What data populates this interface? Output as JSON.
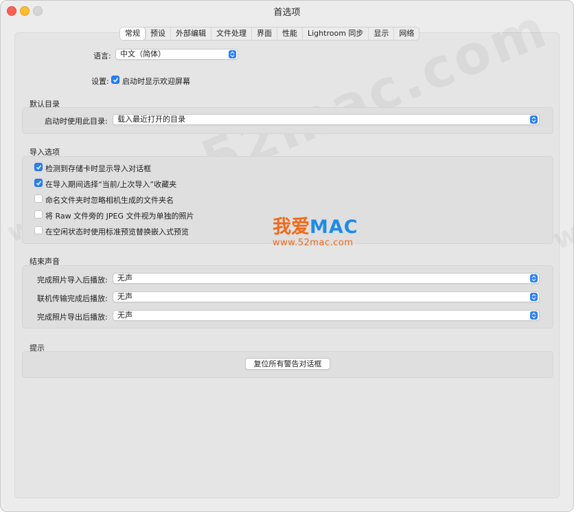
{
  "window": {
    "title": "首选项"
  },
  "tabs": [
    {
      "label": "常规",
      "active": true
    },
    {
      "label": "预设"
    },
    {
      "label": "外部编辑"
    },
    {
      "label": "文件处理"
    },
    {
      "label": "界面"
    },
    {
      "label": "性能"
    },
    {
      "label": "Lightroom 同步"
    },
    {
      "label": "显示"
    },
    {
      "label": "网络"
    }
  ],
  "general": {
    "language_label": "语言:",
    "language_value": "中文（简体）",
    "settings_label": "设置:",
    "show_splash_label": "启动时显示欢迎屏幕",
    "show_splash_checked": true
  },
  "default_catalog": {
    "section_title": "默认目录",
    "label": "启动时使用此目录:",
    "value": "载入最近打开的目录"
  },
  "import_options": {
    "section_title": "导入选项",
    "items": [
      {
        "label": "检测到存储卡时显示导入对话框",
        "checked": true
      },
      {
        "label": "在导入期间选择“当前/上次导入”收藏夹",
        "checked": true
      },
      {
        "label": "命名文件夹时忽略相机生成的文件夹名",
        "checked": false
      },
      {
        "label": "将 Raw 文件旁的 JPEG 文件视为单独的照片",
        "checked": false
      },
      {
        "label": "在空闲状态时使用标准预览替换嵌入式预览",
        "checked": false
      }
    ]
  },
  "completion_sounds": {
    "section_title": "结束声音",
    "rows": [
      {
        "label": "完成照片导入后播放:",
        "value": "无声"
      },
      {
        "label": "联机传输完成后播放:",
        "value": "无声"
      },
      {
        "label": "完成照片导出后播放:",
        "value": "无声"
      }
    ]
  },
  "prompts": {
    "section_title": "提示",
    "reset_button": "复位所有警告对话框"
  },
  "watermark": {
    "logo_cn": "我爱",
    "logo_en": "MAC",
    "url": "www.52mac.com",
    "big_text": "www.52mac.com"
  },
  "colors": {
    "accent": "#2a7ff5",
    "logo_orange": "#f06a1a",
    "logo_blue": "#1f8be8"
  }
}
